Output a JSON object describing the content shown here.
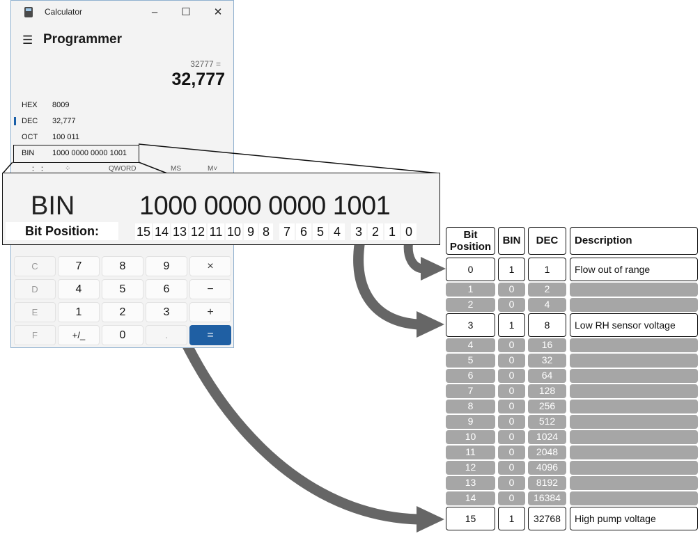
{
  "calculator": {
    "title": "Calculator",
    "window_buttons": [
      "–",
      "☐",
      "✕"
    ],
    "menu_icon": "hamburger-icon",
    "mode": "Programmer",
    "expression": "32777 =",
    "result": "32,777",
    "radix": [
      {
        "label": "HEX",
        "value": "8009"
      },
      {
        "label": "DEC",
        "value": "32,777"
      },
      {
        "label": "OCT",
        "value": "100 011"
      },
      {
        "label": "BIN",
        "value": "1000 0000 0000 1001"
      }
    ],
    "word_bar": [
      "QWORD",
      "MS",
      "M˅"
    ],
    "keys": [
      [
        "C",
        "7",
        "8",
        "9",
        "×"
      ],
      [
        "D",
        "4",
        "5",
        "6",
        "−"
      ],
      [
        "E",
        "1",
        "2",
        "3",
        "+"
      ],
      [
        "F",
        "+/_",
        "0",
        ".",
        "="
      ]
    ]
  },
  "magnifier": {
    "label": "BIN",
    "value": "1000 0000 0000 1001",
    "bit_position_label": "Bit Position:",
    "bit_groups": [
      [
        "15",
        "14",
        "13",
        "12"
      ],
      [
        "11",
        "10",
        "9",
        "8"
      ],
      [
        "7",
        "6",
        "5",
        "4"
      ],
      [
        "3",
        "2",
        "1",
        "0"
      ]
    ]
  },
  "table": {
    "headers": [
      "Bit\nPosition",
      "BIN",
      "DEC",
      "Description"
    ],
    "rows": [
      {
        "bit": "0",
        "bin": "1",
        "dec": "1",
        "desc": "Flow out of range",
        "highlight": true
      },
      {
        "bit": "1",
        "bin": "0",
        "dec": "2",
        "desc": "",
        "highlight": false
      },
      {
        "bit": "2",
        "bin": "0",
        "dec": "4",
        "desc": "",
        "highlight": false
      },
      {
        "bit": "3",
        "bin": "1",
        "dec": "8",
        "desc": "Low RH sensor voltage",
        "highlight": true
      },
      {
        "bit": "4",
        "bin": "0",
        "dec": "16",
        "desc": "",
        "highlight": false
      },
      {
        "bit": "5",
        "bin": "0",
        "dec": "32",
        "desc": "",
        "highlight": false
      },
      {
        "bit": "6",
        "bin": "0",
        "dec": "64",
        "desc": "",
        "highlight": false
      },
      {
        "bit": "7",
        "bin": "0",
        "dec": "128",
        "desc": "",
        "highlight": false
      },
      {
        "bit": "8",
        "bin": "0",
        "dec": "256",
        "desc": "",
        "highlight": false
      },
      {
        "bit": "9",
        "bin": "0",
        "dec": "512",
        "desc": "",
        "highlight": false
      },
      {
        "bit": "10",
        "bin": "0",
        "dec": "1024",
        "desc": "",
        "highlight": false
      },
      {
        "bit": "11",
        "bin": "0",
        "dec": "2048",
        "desc": "",
        "highlight": false
      },
      {
        "bit": "12",
        "bin": "0",
        "dec": "4096",
        "desc": "",
        "highlight": false
      },
      {
        "bit": "13",
        "bin": "0",
        "dec": "8192",
        "desc": "",
        "highlight": false
      },
      {
        "bit": "14",
        "bin": "0",
        "dec": "16384",
        "desc": "",
        "highlight": false
      },
      {
        "bit": "15",
        "bin": "1",
        "dec": "32768",
        "desc": "High pump voltage",
        "highlight": true
      }
    ]
  },
  "colors": {
    "accent": "#1f5fa3",
    "row_gray": "#a6a6a6",
    "arrow": "#666666"
  }
}
